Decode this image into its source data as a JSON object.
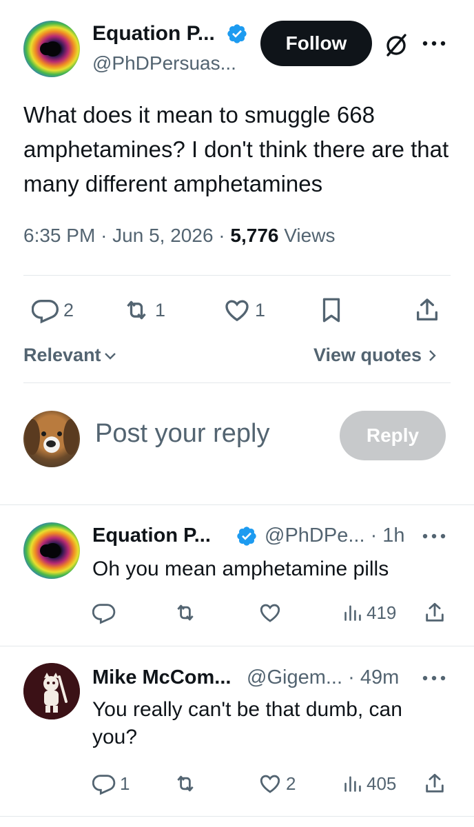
{
  "main_post": {
    "author_name": "Equation P...",
    "author_handle": "@PhDPersuas...",
    "follow_label": "Follow",
    "text": "What does it mean to smuggle 668 amphetamines?  I don't think there are that many different amphetamines",
    "time": "6:35 PM",
    "date": "Jun 5, 2026",
    "views_count": "5,776",
    "views_label": "Views",
    "replies": "2",
    "reposts": "1",
    "likes": "1"
  },
  "sort": {
    "relevant_label": "Relevant",
    "view_quotes_label": "View quotes"
  },
  "composer": {
    "placeholder": "Post your reply",
    "reply_label": "Reply"
  },
  "replies": [
    {
      "author_name": "Equation P...",
      "author_handle": "@PhDPe...",
      "time": "1h",
      "text": "Oh you mean amphetamine pills",
      "replies": "",
      "reposts": "",
      "likes": "",
      "views": "419"
    },
    {
      "author_name": "Mike McCom...",
      "author_handle": "@Gigem...",
      "time": "49m",
      "text": "You really can't be that dumb, can you?",
      "replies": "1",
      "reposts": "",
      "likes": "2",
      "views": "405"
    }
  ],
  "colors": {
    "text": "#0f1419",
    "muted": "#536471",
    "verified": "#1d9bf0",
    "follow_bg": "#0f1419",
    "reply_btn_disabled": "#c7c9cb"
  }
}
